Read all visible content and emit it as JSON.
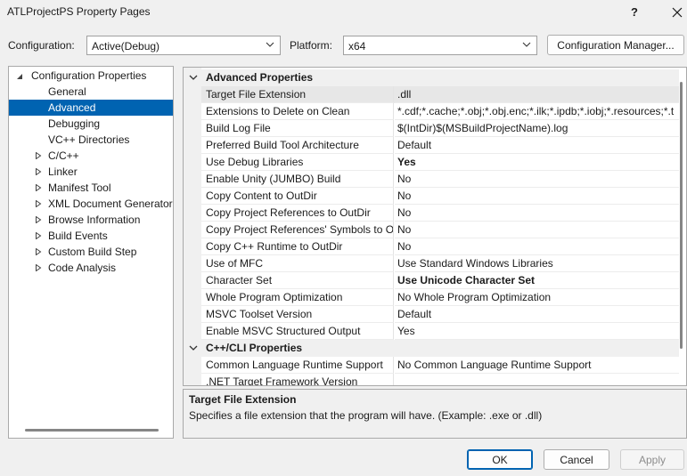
{
  "window": {
    "title": "ATLProjectPS Property Pages",
    "help": "?",
    "close": "✕"
  },
  "toolbar": {
    "configuration_label": "Configuration:",
    "configuration_value": "Active(Debug)",
    "platform_label": "Platform:",
    "platform_value": "x64",
    "config_manager_label": "Configuration Manager..."
  },
  "tree": {
    "root": "Configuration Properties",
    "items": [
      {
        "label": "General",
        "expandable": false,
        "selected": false
      },
      {
        "label": "Advanced",
        "expandable": false,
        "selected": true
      },
      {
        "label": "Debugging",
        "expandable": false,
        "selected": false
      },
      {
        "label": "VC++ Directories",
        "expandable": false,
        "selected": false
      },
      {
        "label": "C/C++",
        "expandable": true,
        "selected": false
      },
      {
        "label": "Linker",
        "expandable": true,
        "selected": false
      },
      {
        "label": "Manifest Tool",
        "expandable": true,
        "selected": false
      },
      {
        "label": "XML Document Generator",
        "expandable": true,
        "selected": false
      },
      {
        "label": "Browse Information",
        "expandable": true,
        "selected": false
      },
      {
        "label": "Build Events",
        "expandable": true,
        "selected": false
      },
      {
        "label": "Custom Build Step",
        "expandable": true,
        "selected": false
      },
      {
        "label": "Code Analysis",
        "expandable": true,
        "selected": false
      }
    ]
  },
  "grid": {
    "category1": "Advanced Properties",
    "properties1": [
      {
        "name": "Target File Extension",
        "value": ".dll",
        "bold": false,
        "selected": true
      },
      {
        "name": "Extensions to Delete on Clean",
        "value": "*.cdf;*.cache;*.obj;*.obj.enc;*.ilk;*.ipdb;*.iobj;*.resources;*.t",
        "bold": false
      },
      {
        "name": "Build Log File",
        "value": "$(IntDir)$(MSBuildProjectName).log",
        "bold": false
      },
      {
        "name": "Preferred Build Tool Architecture",
        "value": "Default",
        "bold": false
      },
      {
        "name": "Use Debug Libraries",
        "value": "Yes",
        "bold": true
      },
      {
        "name": "Enable Unity (JUMBO) Build",
        "value": "No",
        "bold": false
      },
      {
        "name": "Copy Content to OutDir",
        "value": "No",
        "bold": false
      },
      {
        "name": "Copy Project References to OutDir",
        "value": "No",
        "bold": false
      },
      {
        "name": "Copy Project References' Symbols to OutDir",
        "value": "No",
        "bold": false
      },
      {
        "name": "Copy C++ Runtime to OutDir",
        "value": "No",
        "bold": false
      },
      {
        "name": "Use of MFC",
        "value": "Use Standard Windows Libraries",
        "bold": false
      },
      {
        "name": "Character Set",
        "value": "Use Unicode Character Set",
        "bold": true
      },
      {
        "name": "Whole Program Optimization",
        "value": "No Whole Program Optimization",
        "bold": false
      },
      {
        "name": "MSVC Toolset Version",
        "value": "Default",
        "bold": false
      },
      {
        "name": "Enable MSVC Structured Output",
        "value": "Yes",
        "bold": false
      }
    ],
    "category2": "C++/CLI Properties",
    "properties2": [
      {
        "name": "Common Language Runtime Support",
        "value": "No Common Language Runtime Support",
        "bold": false
      },
      {
        "name": ".NET Target Framework Version",
        "value": "",
        "bold": false
      }
    ]
  },
  "description": {
    "title": "Target File Extension",
    "body": "Specifies a file extension that the program will have. (Example: .exe or .dll)"
  },
  "buttons": {
    "ok": "OK",
    "cancel": "Cancel",
    "apply": "Apply"
  },
  "colors": {
    "selection": "#0063b1",
    "background": "#f0f0f0"
  }
}
